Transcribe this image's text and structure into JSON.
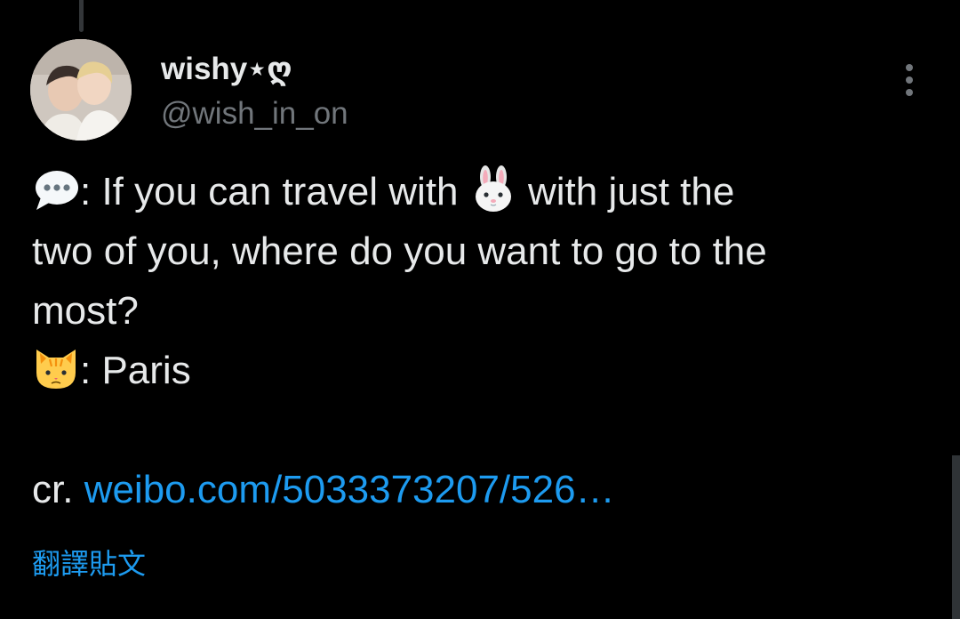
{
  "author": {
    "display_name": "wishy⋆ღ",
    "handle": "@wish_in_on"
  },
  "tweet": {
    "line1_prefix": ": If you can travel with",
    "line1_suffix": "with just the",
    "line2": "two of you, where do you want to go to the",
    "line3": "most?",
    "line4_text": ": Paris",
    "credit_prefix": "cr.",
    "credit_link": "weibo.com/5033373207/526…"
  },
  "icons": {
    "speech": "speech-bubble-icon",
    "rabbit": "rabbit-face-icon",
    "cat": "cat-face-icon",
    "more": "more-options-icon"
  },
  "actions": {
    "translate_label": "翻譯貼文"
  },
  "colors": {
    "background": "#000000",
    "text_primary": "#e7e9ea",
    "text_secondary": "#71767b",
    "link": "#1d9bf0"
  }
}
